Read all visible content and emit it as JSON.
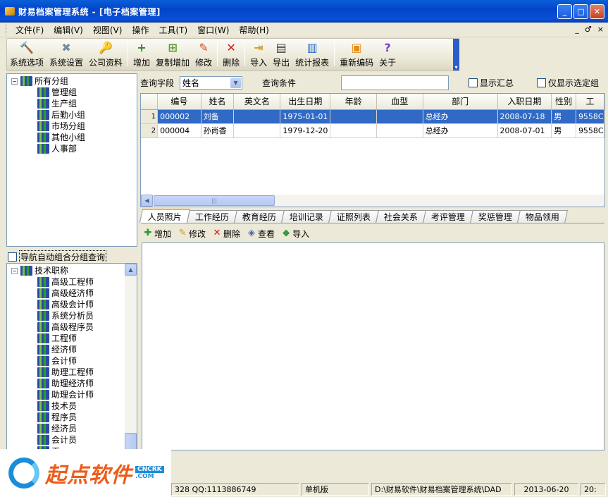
{
  "window": {
    "title": "财易档案管理系统 - [电子档案管理]",
    "min_label": "_",
    "max_label": "□",
    "close_label": "✕"
  },
  "menu": [
    "文件(F)",
    "编辑(V)",
    "视图(V)",
    "操作",
    "工具(T)",
    "窗口(W)",
    "帮助(H)"
  ],
  "mdi_controls": [
    "_",
    "♂",
    "×"
  ],
  "toolbar": [
    {
      "label": "系统选项",
      "icon": "tools-icon",
      "glyph": "🔨",
      "color": "#c98a10"
    },
    {
      "label": "系统设置",
      "icon": "wrench-icon",
      "glyph": "✖",
      "color": "#7b8aa0"
    },
    {
      "label": "公司资料",
      "icon": "keys-icon",
      "glyph": "🔑",
      "color": "#c49a1a"
    },
    {
      "label": "增加",
      "icon": "add-user-icon",
      "glyph": "+",
      "color": "#2b8a2b"
    },
    {
      "label": "复制增加",
      "icon": "copy-add-icon",
      "glyph": "⊞",
      "color": "#5b9a2b"
    },
    {
      "label": "修改",
      "icon": "pencil-icon",
      "glyph": "✎",
      "color": "#d24a1a"
    },
    {
      "label": "删除",
      "icon": "delete-icon",
      "glyph": "✕",
      "color": "#d01818"
    },
    {
      "label": "导入",
      "icon": "import-icon",
      "glyph": "⇥",
      "color": "#d8a020"
    },
    {
      "label": "导出",
      "icon": "printer-icon",
      "glyph": "▤",
      "color": "#404040"
    },
    {
      "label": "统计报表",
      "icon": "chart-icon",
      "glyph": "▥",
      "color": "#2a70c8"
    },
    {
      "label": "重新编码",
      "icon": "renumber-icon",
      "glyph": "▣",
      "color": "#e09020"
    },
    {
      "label": "关于",
      "icon": "help-icon",
      "glyph": "?",
      "color": "#7a3ad0"
    }
  ],
  "group_tree": {
    "root": "所有分组",
    "items": [
      "管理组",
      "生产组",
      "后勤小组",
      "市场分组",
      "其他小组",
      "人事部"
    ]
  },
  "auto_group_checkbox": "导航自动组合分组查询",
  "title_tree": {
    "root": "技术职称",
    "items": [
      "高级工程师",
      "高级经济师",
      "高级会计师",
      "系统分析员",
      "高级程序员",
      "工程师",
      "经济师",
      "会计师",
      "助理工程师",
      "助理经济师",
      "助理会计师",
      "技术员",
      "程序员",
      "经济员",
      "会计员",
      "工"
    ]
  },
  "query": {
    "field_label": "查询字段",
    "field_value": "姓名",
    "condition_label": "查询条件",
    "show_summary": "显示汇总",
    "only_selected": "仅显示选定组"
  },
  "grid": {
    "columns": [
      "编号",
      "姓名",
      "英文名",
      "出生日期",
      "年龄",
      "血型",
      "部门",
      "入职日期",
      "性别",
      "工"
    ],
    "rows": [
      {
        "n": "1",
        "cells": [
          "000002",
          "刘备",
          "",
          "1975-01-01",
          "",
          "",
          "总经办",
          "2008-07-18",
          "男",
          "9558C"
        ]
      },
      {
        "n": "2",
        "cells": [
          "000004",
          "孙尚香",
          "",
          "1979-12-20",
          "",
          "",
          "总经办",
          "2008-07-01",
          "男",
          "9558C"
        ]
      }
    ],
    "scroll_grip": "|||"
  },
  "tabs": [
    "人员照片",
    "工作经历",
    "教育经历",
    "培训记录",
    "证照列表",
    "社会关系",
    "考评管理",
    "奖惩管理",
    "物品领用"
  ],
  "sub_toolbar": [
    {
      "label": "增加",
      "icon": "add-icon",
      "glyph": "✚",
      "color": "#2b9a2b"
    },
    {
      "label": "修改",
      "icon": "edit-icon",
      "glyph": "✎",
      "color": "#c8a020"
    },
    {
      "label": "删除",
      "icon": "delete-icon",
      "glyph": "✕",
      "color": "#d01818"
    },
    {
      "label": "查看",
      "icon": "view-icon",
      "glyph": "◈",
      "color": "#4a6ab0"
    },
    {
      "label": "导入",
      "icon": "import-icon",
      "glyph": "◆",
      "color": "#3a9a3a"
    }
  ],
  "status": [
    "328 QQ:1113886749",
    "单机版",
    "D:\\财易软件\\财易档案管理系统\\DAD",
    "2013-06-20",
    "20:"
  ],
  "watermark": {
    "text": "起点软件",
    "badge_top": "CNCRK",
    "badge_bottom": ".COM"
  }
}
